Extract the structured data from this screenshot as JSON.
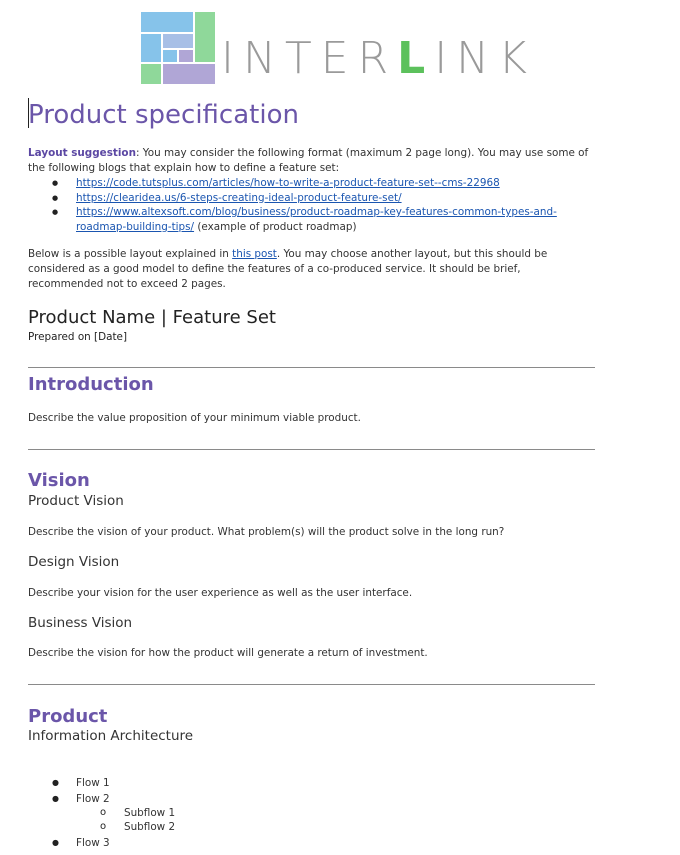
{
  "logo": {
    "text_main": "INTER",
    "text_accent": "L",
    "text_end": "INK"
  },
  "document": {
    "title": "Product specification",
    "layout_suggestion": {
      "label": "Layout suggestion",
      "text": ": You may consider the following format (maximum 2 page long). You may use some of the following blogs that explain how to define a feature set:"
    },
    "links": [
      {
        "url": "https://code.tutsplus.com/articles/how-to-write-a-product-feature-set--cms-22968",
        "suffix": ""
      },
      {
        "url": "https://clearidea.us/6-steps-creating-ideal-product-feature-set/",
        "suffix": ""
      },
      {
        "url": "https://www.altexsoft.com/blog/business/product-roadmap-key-features-common-types-and-roadmap-building-tips/",
        "suffix": " (example of product roadmap)"
      }
    ],
    "below_text_1": "Below is a possible layout explained in ",
    "below_link": "this post",
    "below_text_2": ".  You may choose another layout, but this should be considered as a good model to define the features of a co-produced service. It should be brief, recommended not to exceed 2 pages.",
    "product_heading": "Product Name | Feature Set",
    "prepared_on": "Prepared on [Date]",
    "introduction": {
      "heading": "Introduction",
      "text": "Describe the value proposition of your minimum viable product."
    },
    "vision": {
      "heading": "Vision",
      "product_vision": "Product Vision",
      "product_vision_text": "Describe the vision of your product. What problem(s) will the product solve in the long run?",
      "design_vision": "Design Vision",
      "design_vision_text": "Describe your vision for the user experience as well as the user interface.",
      "business_vision": "Business Vision",
      "business_vision_text": "Describe the vision for how the product will generate a return of investment."
    },
    "product": {
      "heading": "Product",
      "info_arch": "Information Architecture",
      "flows": [
        "Flow 1",
        "Flow 2",
        "Flow 3"
      ],
      "subflows": [
        "Subflow 1",
        "Subflow 2"
      ]
    }
  },
  "colors": {
    "heading_purple": "#6b56a9",
    "link_blue": "#1a55b0",
    "logo_green": "#5cc15c",
    "logo_lilac": "#b0a6d6",
    "logo_sky": "#86c3ea",
    "logo_mint": "#8fd89a"
  }
}
